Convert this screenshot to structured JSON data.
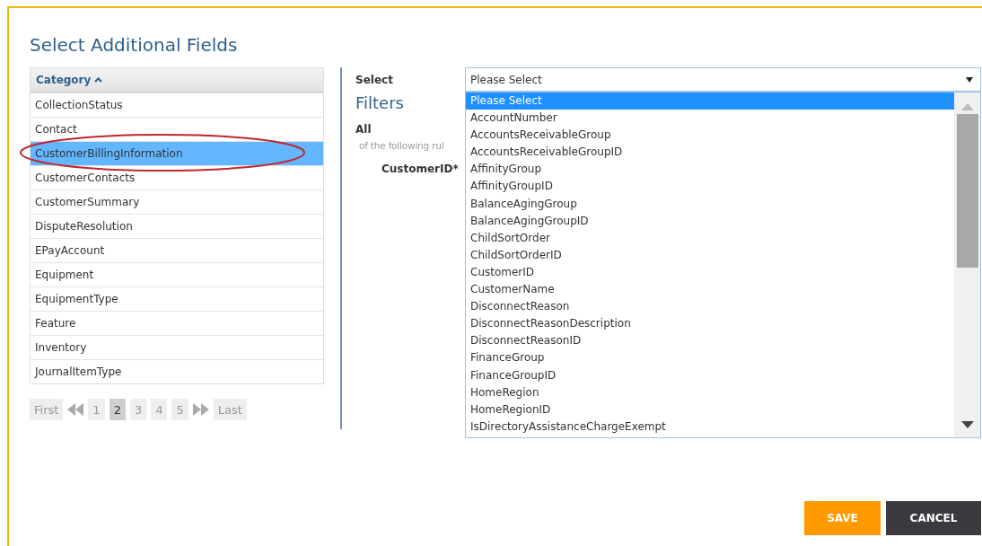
{
  "title": "Select Additional Fields",
  "category_table": {
    "header": "Category",
    "rows": [
      {
        "label": "CollectionStatus",
        "selected": false
      },
      {
        "label": "Contact",
        "selected": false
      },
      {
        "label": "CustomerBillingInformation",
        "selected": true
      },
      {
        "label": "CustomerContacts",
        "selected": false
      },
      {
        "label": "CustomerSummary",
        "selected": false
      },
      {
        "label": "DisputeResolution",
        "selected": false
      },
      {
        "label": "EPayAccount",
        "selected": false
      },
      {
        "label": "Equipment",
        "selected": false
      },
      {
        "label": "EquipmentType",
        "selected": false
      },
      {
        "label": "Feature",
        "selected": false
      },
      {
        "label": "Inventory",
        "selected": false
      },
      {
        "label": "JournalItemType",
        "selected": false
      }
    ]
  },
  "pagination": {
    "first": "First",
    "last": "Last",
    "pages": [
      {
        "label": "1",
        "selected": false
      },
      {
        "label": "2",
        "selected": true
      },
      {
        "label": "3",
        "selected": false
      },
      {
        "label": "4",
        "selected": false
      },
      {
        "label": "5",
        "selected": false
      }
    ]
  },
  "select_label": "Select",
  "select": {
    "value": "Please Select",
    "expanded": true,
    "options": [
      {
        "label": "Please Select",
        "selected": true
      },
      {
        "label": "AccountNumber",
        "selected": false
      },
      {
        "label": "AccountsReceivableGroup",
        "selected": false
      },
      {
        "label": "AccountsReceivableGroupID",
        "selected": false
      },
      {
        "label": "AffinityGroup",
        "selected": false
      },
      {
        "label": "AffinityGroupID",
        "selected": false
      },
      {
        "label": "BalanceAgingGroup",
        "selected": false
      },
      {
        "label": "BalanceAgingGroupID",
        "selected": false
      },
      {
        "label": "ChildSortOrder",
        "selected": false
      },
      {
        "label": "ChildSortOrderID",
        "selected": false
      },
      {
        "label": "CustomerID",
        "selected": false
      },
      {
        "label": "CustomerName",
        "selected": false
      },
      {
        "label": "DisconnectReason",
        "selected": false
      },
      {
        "label": "DisconnectReasonDescription",
        "selected": false
      },
      {
        "label": "DisconnectReasonID",
        "selected": false
      },
      {
        "label": "FinanceGroup",
        "selected": false
      },
      {
        "label": "FinanceGroupID",
        "selected": false
      },
      {
        "label": "HomeRegion",
        "selected": false
      },
      {
        "label": "HomeRegionID",
        "selected": false
      },
      {
        "label": "IsDirectoryAssistanceChargeExempt",
        "selected": false
      }
    ]
  },
  "filters": {
    "title": "Filters",
    "match": "All",
    "rule_text": "of the following rul",
    "field": "CustomerID*"
  },
  "buttons": [
    {
      "label": "SAVE",
      "kind": "primary"
    },
    {
      "label": "CANCEL",
      "kind": "secondary"
    }
  ]
}
